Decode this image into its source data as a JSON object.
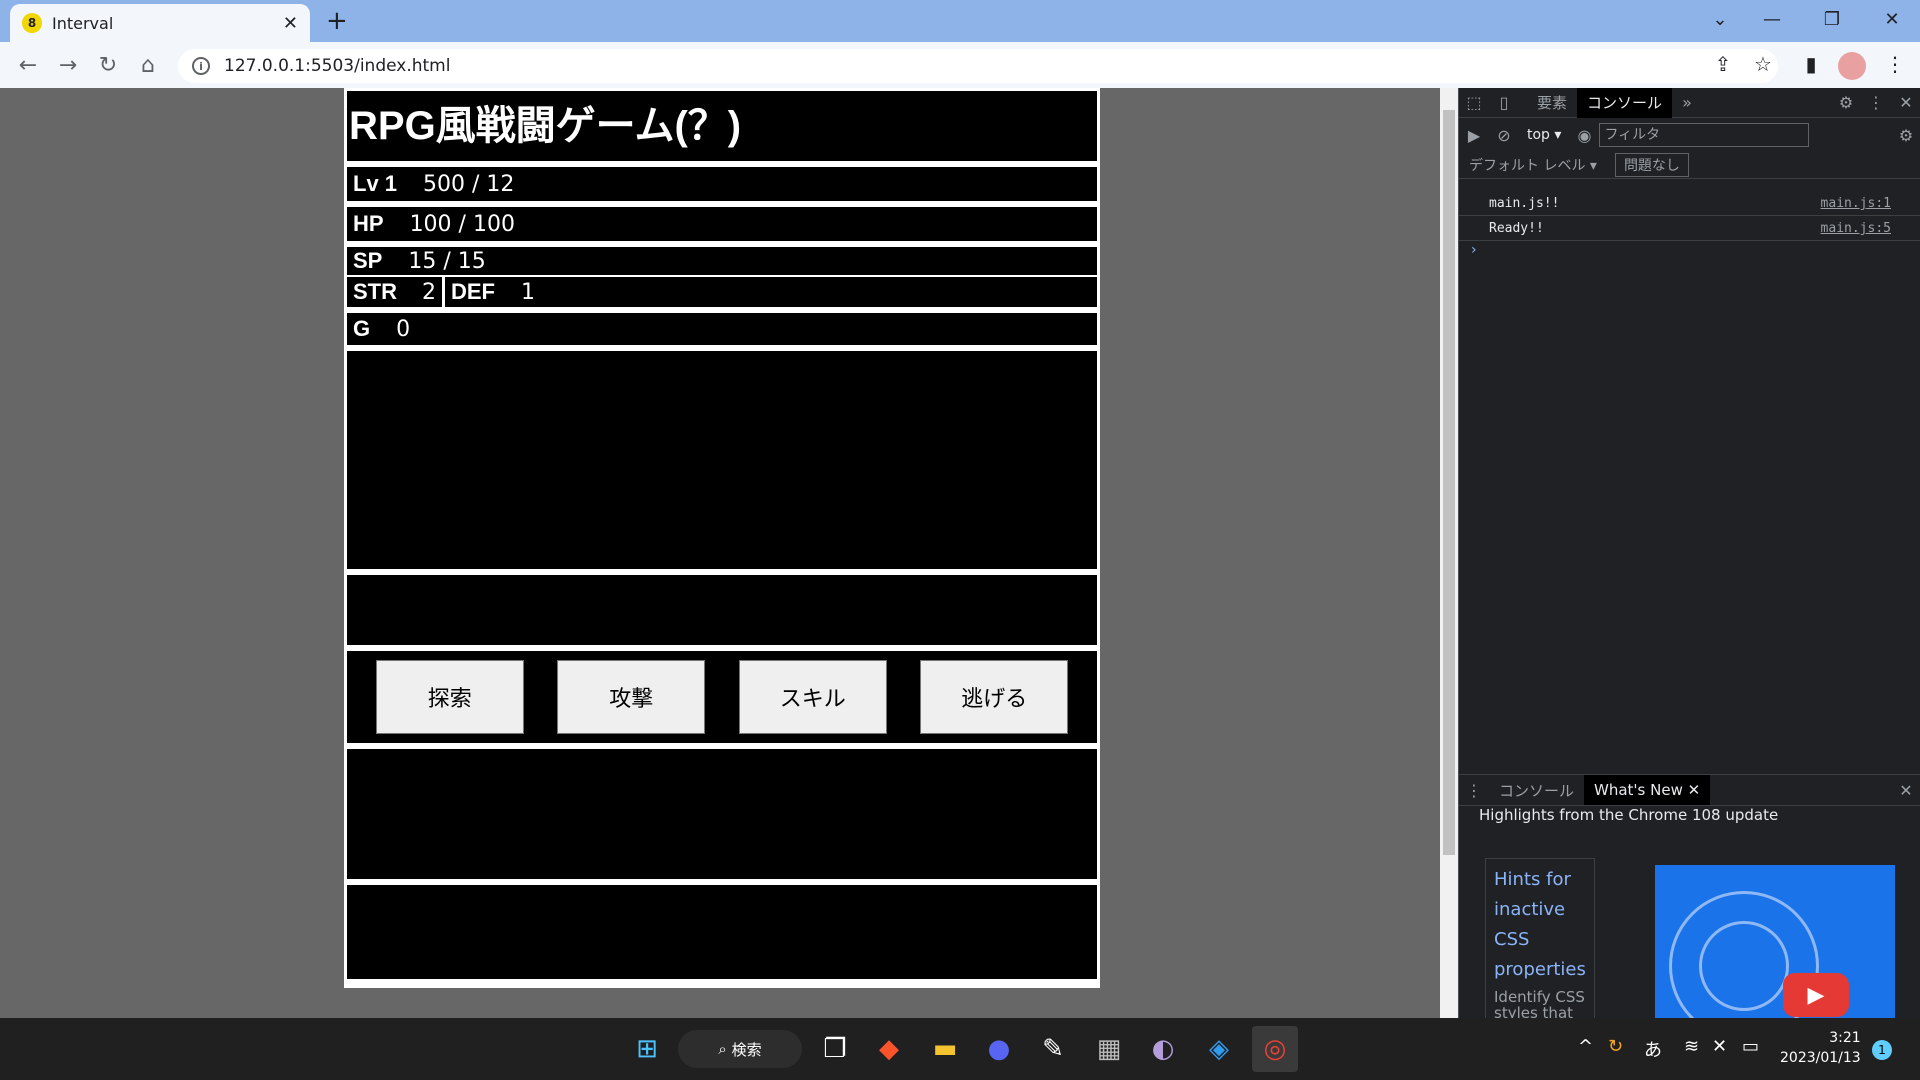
{
  "browser": {
    "tab_title": "Interval",
    "favicon_text": "8",
    "url": "127.0.0.1:5503/index.html"
  },
  "game": {
    "title": "RPG風戦闘ゲーム(？)",
    "lv_label": "Lv 1",
    "exp": "500 / 12",
    "hp_label": "HP",
    "hp": "100 / 100",
    "sp_label": "SP",
    "sp": "15 / 15",
    "str_label": "STR",
    "str": "2",
    "def_label": "DEF",
    "def": "1",
    "g_label": "G",
    "gold": "0",
    "buttons": [
      "探索",
      "攻撃",
      "スキル",
      "逃げる"
    ]
  },
  "devtools": {
    "tab_elements": "要素",
    "tab_console": "コンソール",
    "context": "top",
    "filter_placeholder": "フィルタ",
    "level": "デフォルト レベル",
    "issues": "問題なし",
    "logs": [
      {
        "text": "main.js!!",
        "src": "main.js:1"
      },
      {
        "text": "Ready!!",
        "src": "main.js:5"
      }
    ],
    "drawer_tab_console": "コンソール",
    "drawer_tab_whatsnew": "What's New",
    "whatsnew_heading": "Highlights from the Chrome 108 update",
    "hint_link": "Hints for inactive CSS properties",
    "hint_desc": "Identify CSS styles that are entirely"
  },
  "taskbar": {
    "search_label": "検索",
    "ime": "あ",
    "time": "3:21",
    "date": "2023/01/13",
    "notif_count": "1"
  }
}
